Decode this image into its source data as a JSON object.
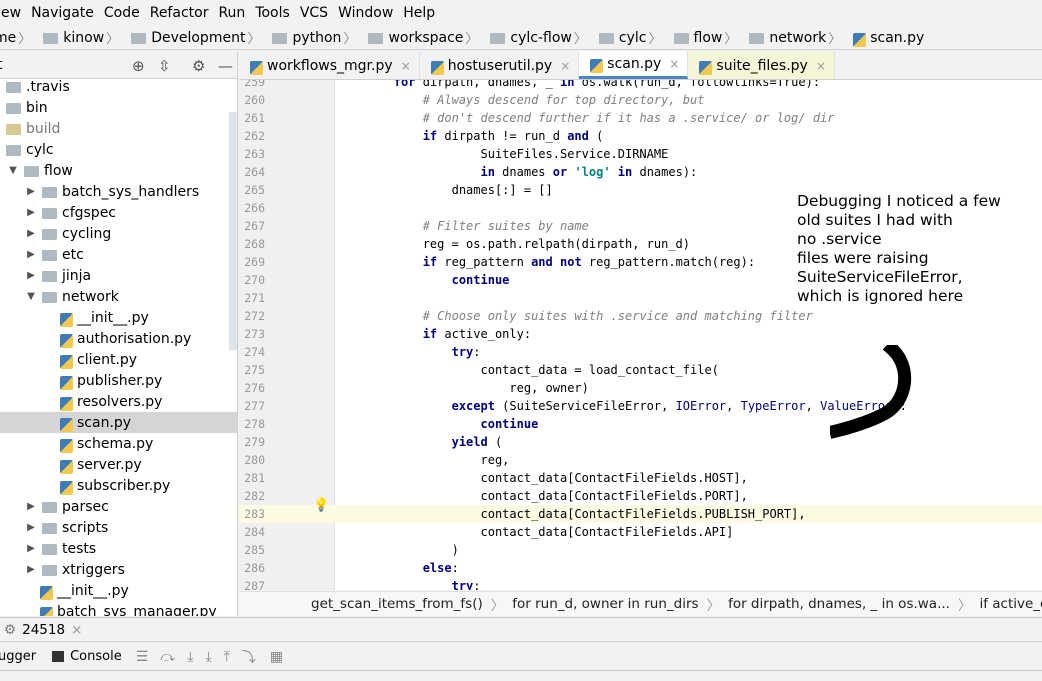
{
  "menu": [
    "ew",
    "Navigate",
    "Code",
    "Refactor",
    "Run",
    "Tools",
    "VCS",
    "Window",
    "Help"
  ],
  "breadcrumb": [
    "me",
    "kinow",
    "Development",
    "python",
    "workspace",
    "cylc-flow",
    "cylc",
    "flow",
    "network",
    "scan.py"
  ],
  "sidebar": {
    "title": "t",
    "items": [
      {
        "label": ".travis",
        "depth": 0,
        "type": "folder"
      },
      {
        "label": "bin",
        "depth": 0,
        "type": "folder"
      },
      {
        "label": "build",
        "depth": 0,
        "type": "folder-yellow"
      },
      {
        "label": "cylc",
        "depth": 0,
        "type": "folder"
      },
      {
        "label": "flow",
        "depth": 1,
        "type": "folder",
        "arrow": "open"
      },
      {
        "label": "batch_sys_handlers",
        "depth": 2,
        "type": "folder",
        "arrow": "closed"
      },
      {
        "label": "cfgspec",
        "depth": 2,
        "type": "folder",
        "arrow": "closed"
      },
      {
        "label": "cycling",
        "depth": 2,
        "type": "folder",
        "arrow": "closed"
      },
      {
        "label": "etc",
        "depth": 2,
        "type": "folder",
        "arrow": "closed"
      },
      {
        "label": "jinja",
        "depth": 2,
        "type": "folder",
        "arrow": "closed"
      },
      {
        "label": "network",
        "depth": 2,
        "type": "folder",
        "arrow": "open"
      },
      {
        "label": "__init__.py",
        "depth": 3,
        "type": "py"
      },
      {
        "label": "authorisation.py",
        "depth": 3,
        "type": "py"
      },
      {
        "label": "client.py",
        "depth": 3,
        "type": "py"
      },
      {
        "label": "publisher.py",
        "depth": 3,
        "type": "py"
      },
      {
        "label": "resolvers.py",
        "depth": 3,
        "type": "py"
      },
      {
        "label": "scan.py",
        "depth": 3,
        "type": "py",
        "selected": true
      },
      {
        "label": "schema.py",
        "depth": 3,
        "type": "py"
      },
      {
        "label": "server.py",
        "depth": 3,
        "type": "py"
      },
      {
        "label": "subscriber.py",
        "depth": 3,
        "type": "py"
      },
      {
        "label": "parsec",
        "depth": 2,
        "type": "folder",
        "arrow": "closed"
      },
      {
        "label": "scripts",
        "depth": 2,
        "type": "folder",
        "arrow": "closed"
      },
      {
        "label": "tests",
        "depth": 2,
        "type": "folder",
        "arrow": "closed"
      },
      {
        "label": "xtriggers",
        "depth": 2,
        "type": "folder",
        "arrow": "closed"
      },
      {
        "label": "__init__.py",
        "depth": 2.5,
        "type": "py"
      },
      {
        "label": "batch_sys_manager.py",
        "depth": 2.5,
        "type": "py"
      }
    ]
  },
  "tabs": [
    {
      "label": "workflows_mgr.py",
      "active": false
    },
    {
      "label": "hostuserutil.py",
      "active": false
    },
    {
      "label": "scan.py",
      "active": true
    },
    {
      "label": "suite_files.py",
      "active": false
    }
  ],
  "code": [
    {
      "n": "259",
      "t": "        for dirpath, dnames, _ in os.walk(run_d, followlinks=True):"
    },
    {
      "n": "260",
      "t": "            # Always descend for top directory, but"
    },
    {
      "n": "261",
      "t": "            # don't descend further if it has a .service/ or log/ dir"
    },
    {
      "n": "262",
      "t": "            if dirpath != run_d and ("
    },
    {
      "n": "263",
      "t": "                    SuiteFiles.Service.DIRNAME"
    },
    {
      "n": "264",
      "t": "                    in dnames or 'log' in dnames):"
    },
    {
      "n": "265",
      "t": "                dnames[:] = []"
    },
    {
      "n": "266",
      "t": ""
    },
    {
      "n": "267",
      "t": "            # Filter suites by name"
    },
    {
      "n": "268",
      "t": "            reg = os.path.relpath(dirpath, run_d)"
    },
    {
      "n": "269",
      "t": "            if reg_pattern and not reg_pattern.match(reg):"
    },
    {
      "n": "270",
      "t": "                continue"
    },
    {
      "n": "271",
      "t": ""
    },
    {
      "n": "272",
      "t": "            # Choose only suites with .service and matching filter"
    },
    {
      "n": "273",
      "t": "            if active_only:"
    },
    {
      "n": "274",
      "t": "                try:"
    },
    {
      "n": "275",
      "t": "                    contact_data = load_contact_file("
    },
    {
      "n": "276",
      "t": "                        reg, owner)"
    },
    {
      "n": "277",
      "t": "                except (SuiteServiceFileError, IOError, TypeError, ValueError):"
    },
    {
      "n": "278",
      "t": "                    continue"
    },
    {
      "n": "279",
      "t": "                yield ("
    },
    {
      "n": "280",
      "t": "                    reg,"
    },
    {
      "n": "281",
      "t": "                    contact_data[ContactFileFields.HOST],"
    },
    {
      "n": "282",
      "t": "                    contact_data[ContactFileFields.PORT],"
    },
    {
      "n": "283",
      "t": "                    contact_data[ContactFileFields.PUBLISH_PORT],"
    },
    {
      "n": "284",
      "t": "                    contact_data[ContactFileFields.API]"
    },
    {
      "n": "285",
      "t": "                )"
    },
    {
      "n": "286",
      "t": "            else:"
    },
    {
      "n": "287",
      "t": "                try:"
    }
  ],
  "annotation": "Debugging I noticed a few\nold suites I had with\nno .service\nfiles were raising\nSuiteServiceFileError,\nwhich is ignored here",
  "status_crumbs": [
    "get_scan_items_from_fs()",
    "for run_d, owner in run_dirs",
    "for dirpath, dnames, _ in os.wa...",
    "if active_only"
  ],
  "run_tab": {
    "label": "24518",
    "close": "×"
  },
  "bottom": {
    "debugger_label": "ugger",
    "console_label": "Console"
  }
}
